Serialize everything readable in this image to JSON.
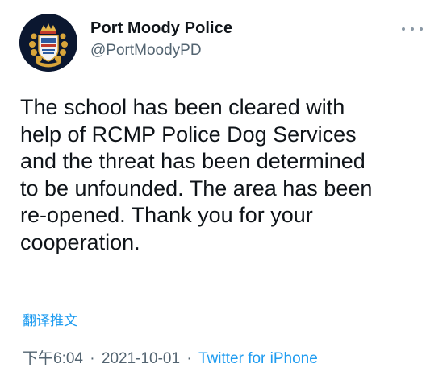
{
  "author": {
    "name": "Port Moody Police",
    "handle": "@PortMoodyPD"
  },
  "menu": {
    "icon": "more-horizontal-icon"
  },
  "tweet": {
    "text": "The school has been cleared with\nhelp of RCMP Police Dog Services\nand the threat has been determined\nto be unfounded. The area has been\nre-opened. Thank you for your\ncooperation.",
    "translate_label": "翻译推文",
    "time": "下午6:04",
    "date": "2021-10-01",
    "separator": "·",
    "source": "Twitter for iPhone"
  },
  "colors": {
    "link": "#1d9bf0",
    "secondary_text": "#536471",
    "primary_text": "#0f1419",
    "avatar_bg": "#0b1730"
  }
}
